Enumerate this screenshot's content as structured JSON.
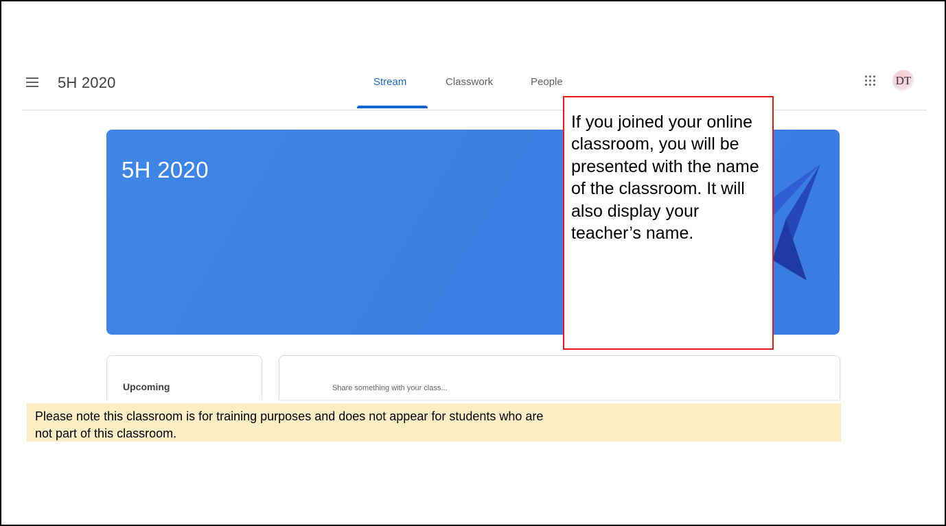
{
  "header": {
    "class_name": "5H 2020",
    "tabs": [
      {
        "label": "Stream",
        "active": true
      },
      {
        "label": "Classwork",
        "active": false
      },
      {
        "label": "People",
        "active": false
      }
    ],
    "avatar_initials": "DT"
  },
  "banner": {
    "title": "5H 2020",
    "color": "#3b80e4"
  },
  "upcoming": {
    "title": "Upcoming"
  },
  "share": {
    "placeholder": "Share something with your class..."
  },
  "callout": {
    "text": "If you joined your online classroom, you will be presented with the name of the classroom. It will also display your teacher’s name.",
    "border_color": "#e31b1b"
  },
  "note": {
    "text": "Please note this classroom is for training purposes and does not appear for students who are not part of this classroom.",
    "background": "#fdeec6"
  },
  "colors": {
    "accent": "#1967d2"
  },
  "icons": {
    "menu": "menu-icon",
    "apps": "apps-grid-icon"
  }
}
